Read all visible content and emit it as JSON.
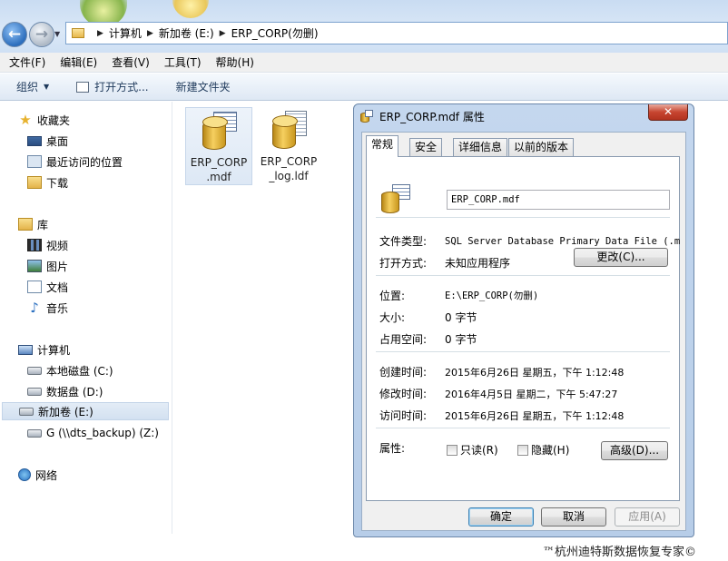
{
  "address": {
    "crumbs": [
      "计算机",
      "新加卷 (E:)",
      "ERP_CORP(勿删)"
    ]
  },
  "menubar": [
    "文件(F)",
    "编辑(E)",
    "查看(V)",
    "工具(T)",
    "帮助(H)"
  ],
  "commandbar": {
    "organize": "组织",
    "open_with": "打开方式...",
    "new_folder": "新建文件夹"
  },
  "navpane": {
    "favorites": "收藏夹",
    "desktop": "桌面",
    "recent": "最近访问的位置",
    "downloads": "下载",
    "libraries": "库",
    "videos": "视频",
    "pictures": "图片",
    "documents": "文档",
    "music": "音乐",
    "computer": "计算机",
    "drive_c": "本地磁盘 (C:)",
    "drive_d": "数据盘 (D:)",
    "drive_e": "新加卷 (E:)",
    "drive_z": "G (\\\\dts_backup) (Z:)",
    "network": "网络"
  },
  "files": [
    {
      "line1": "ERP_CORP",
      "line2": ".mdf",
      "icon": "database-icon"
    },
    {
      "line1": "ERP_CORP",
      "line2": "_log.ldf",
      "icon": "database-log-icon"
    }
  ],
  "dialog": {
    "title": "ERP_CORP.mdf 属性",
    "close": "✕",
    "tabs": [
      "常规",
      "安全",
      "详细信息",
      "以前的版本"
    ],
    "filename": "ERP_CORP.mdf",
    "type_label": "文件类型:",
    "type_value": "SQL Server Database Primary Data File (.m",
    "openwith_label": "打开方式:",
    "openwith_value": "未知应用程序",
    "change_button": "更改(C)...",
    "location_label": "位置:",
    "location_value": "E:\\ERP_CORP(勿删)",
    "size_label": "大小:",
    "size_value": "0 字节",
    "disksize_label": "占用空间:",
    "disksize_value": "0 字节",
    "created_label": "创建时间:",
    "created_value": "2015年6月26日 星期五，下午 1:12:48",
    "modified_label": "修改时间:",
    "modified_value": "2016年4月5日 星期二，下午 5:47:27",
    "accessed_label": "访问时间:",
    "accessed_value": "2015年6月26日 星期五，下午 1:12:48",
    "attr_label": "属性:",
    "readonly_label": "只读(R)",
    "hidden_label": "隐藏(H)",
    "advanced_button": "高级(D)...",
    "ok_button": "确定",
    "cancel_button": "取消",
    "apply_button": "应用(A)"
  },
  "watermark": "™杭州迪特斯数据恢复专家©"
}
